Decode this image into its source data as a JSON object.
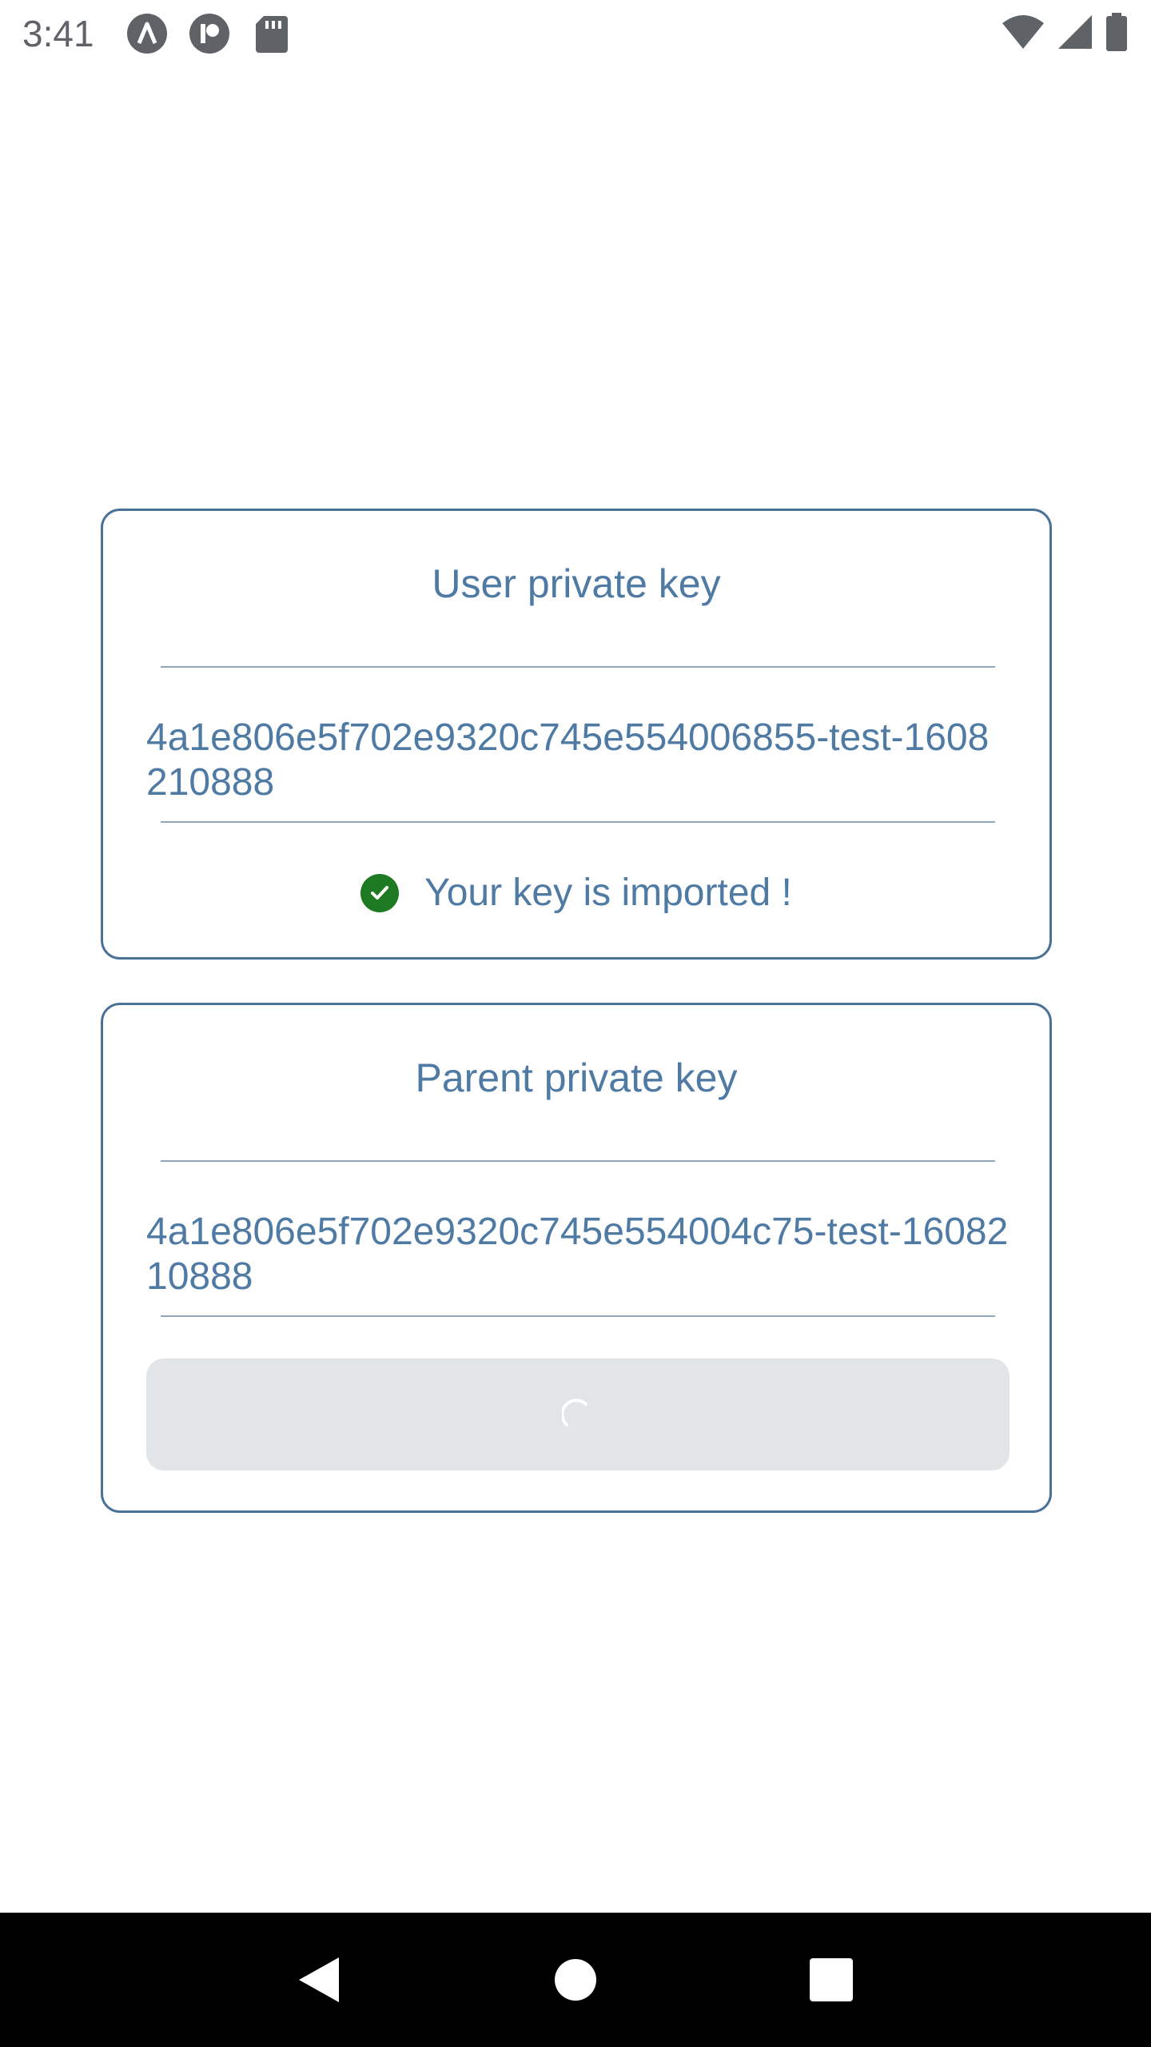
{
  "status_bar": {
    "time": "3:41",
    "icons": [
      "app-a-icon",
      "app-p-icon",
      "sd-card-icon"
    ],
    "right_icons": [
      "wifi-icon",
      "signal-icon",
      "battery-icon"
    ]
  },
  "user_key_card": {
    "title": "User private key",
    "value": "4a1e806e5f702e9320c745e554006855-test-1608210888",
    "status_message": "Your key is imported !",
    "status_color": "#1e7a22"
  },
  "parent_key_card": {
    "title": "Parent private key",
    "value": "4a1e806e5f702e9320c745e554004c75-test-1608210888",
    "button_state": "loading"
  },
  "colors": {
    "accent": "#4f7aa3",
    "border": "#4a7296",
    "button_bg": "#e2e5e8",
    "success": "#1e7a22"
  },
  "nav_bar": {
    "buttons": [
      "back-icon",
      "home-icon",
      "recents-icon"
    ]
  }
}
